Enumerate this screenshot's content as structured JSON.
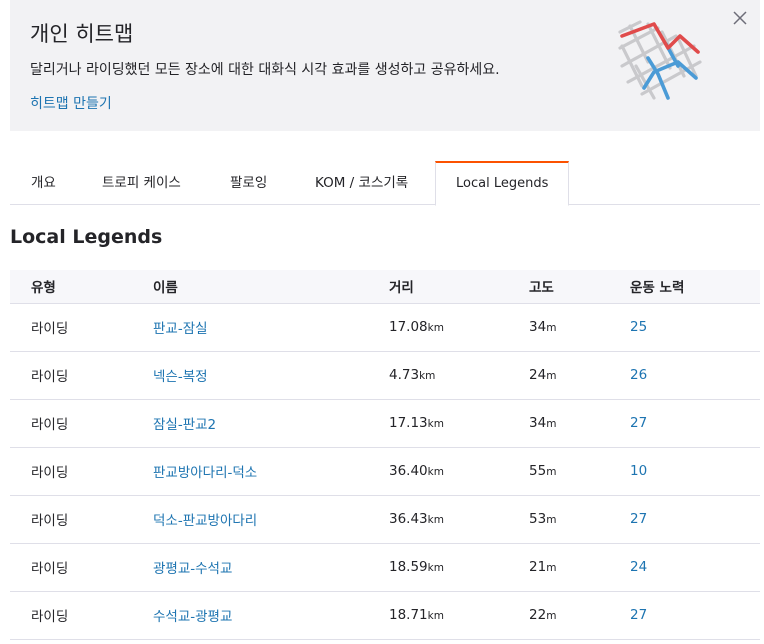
{
  "promo": {
    "title": "개인 히트맵",
    "description": "달리거나 라이딩했던 모든 장소에 대한 대화식 시각 효과를 생성하고 공유하세요.",
    "link": "히트맵 만들기"
  },
  "tabs": [
    {
      "label": "개요"
    },
    {
      "label": "트로피 케이스"
    },
    {
      "label": "팔로잉"
    },
    {
      "label": "KOM / 코스기록"
    },
    {
      "label": "Local Legends",
      "active": true
    }
  ],
  "section_title": "Local Legends",
  "table": {
    "headers": [
      "유형",
      "이름",
      "거리",
      "고도",
      "운동 노력"
    ],
    "rows": [
      {
        "type": "라이딩",
        "name": "판교-잠실",
        "distance": "17.08",
        "distance_unit": "km",
        "elevation": "34",
        "elevation_unit": "m",
        "efforts": "25"
      },
      {
        "type": "라이딩",
        "name": "넥슨-복정",
        "distance": "4.73",
        "distance_unit": "km",
        "elevation": "24",
        "elevation_unit": "m",
        "efforts": "26"
      },
      {
        "type": "라이딩",
        "name": "잠실-판교2",
        "distance": "17.13",
        "distance_unit": "km",
        "elevation": "34",
        "elevation_unit": "m",
        "efforts": "27"
      },
      {
        "type": "라이딩",
        "name": "판교방아다리-덕소",
        "distance": "36.40",
        "distance_unit": "km",
        "elevation": "55",
        "elevation_unit": "m",
        "efforts": "10"
      },
      {
        "type": "라이딩",
        "name": "덕소-판교방아다리",
        "distance": "36.43",
        "distance_unit": "km",
        "elevation": "53",
        "elevation_unit": "m",
        "efforts": "27"
      },
      {
        "type": "라이딩",
        "name": "광평교-수석교",
        "distance": "18.59",
        "distance_unit": "km",
        "elevation": "21",
        "elevation_unit": "m",
        "efforts": "24"
      },
      {
        "type": "라이딩",
        "name": "수석교-광평교",
        "distance": "18.71",
        "distance_unit": "km",
        "elevation": "22",
        "elevation_unit": "m",
        "efforts": "27"
      }
    ]
  },
  "icons": {
    "close": "close-icon",
    "heatmap": "heatmap-illustration-icon"
  },
  "colors": {
    "link": "#1d74b1",
    "accent": "#fc5200",
    "promo_bg": "#f2f2f4"
  }
}
